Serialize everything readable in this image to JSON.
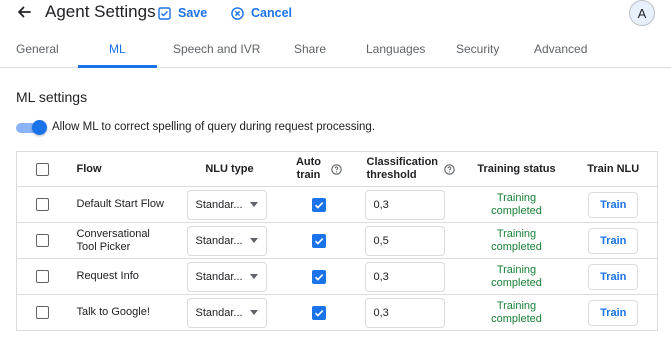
{
  "header": {
    "title": "Agent Settings",
    "save_label": "Save",
    "cancel_label": "Cancel",
    "avatar_initial": "A"
  },
  "tabs": [
    {
      "label": "General",
      "active": false
    },
    {
      "label": "ML",
      "active": true
    },
    {
      "label": "Speech and IVR",
      "active": false
    },
    {
      "label": "Share",
      "active": false
    },
    {
      "label": "Languages",
      "active": false
    },
    {
      "label": "Security",
      "active": false
    },
    {
      "label": "Advanced",
      "active": false
    }
  ],
  "ml_settings": {
    "title": "ML settings",
    "spelling_toggle_label": "Allow ML to correct spelling of query during request processing.",
    "spelling_toggle_on": true
  },
  "table": {
    "headers": {
      "flow": "Flow",
      "nlu_type": "NLU type",
      "auto_train_line1": "Auto",
      "auto_train_line2": "train",
      "threshold_line1": "Classification",
      "threshold_line2": "threshold",
      "training_status": "Training status",
      "train_nlu": "Train NLU"
    },
    "rows": [
      {
        "flow": "Default Start Flow",
        "nlu_type": "Standar...",
        "auto_train": true,
        "threshold": "0,3",
        "status_line1": "Training",
        "status_line2": "completed",
        "train_label": "Train"
      },
      {
        "flow": "Conversational Tool Picker",
        "nlu_type": "Standar...",
        "auto_train": true,
        "threshold": "0,5",
        "status_line1": "Training",
        "status_line2": "completed",
        "train_label": "Train"
      },
      {
        "flow": "Request Info",
        "nlu_type": "Standar...",
        "auto_train": true,
        "threshold": "0,3",
        "status_line1": "Training",
        "status_line2": "completed",
        "train_label": "Train"
      },
      {
        "flow": "Talk to Google!",
        "nlu_type": "Standar...",
        "auto_train": true,
        "threshold": "0,3",
        "status_line1": "Training",
        "status_line2": "completed",
        "train_label": "Train"
      }
    ]
  },
  "icons": {
    "back": "arrow-back-icon",
    "save": "save-icon",
    "cancel": "cancel-circle-icon",
    "help": "help-circle-icon",
    "dropdown": "dropdown-caret-icon"
  },
  "colors": {
    "accent": "#1a73e8",
    "status_success": "#188038",
    "toggle_track": "#8ab4f8"
  }
}
